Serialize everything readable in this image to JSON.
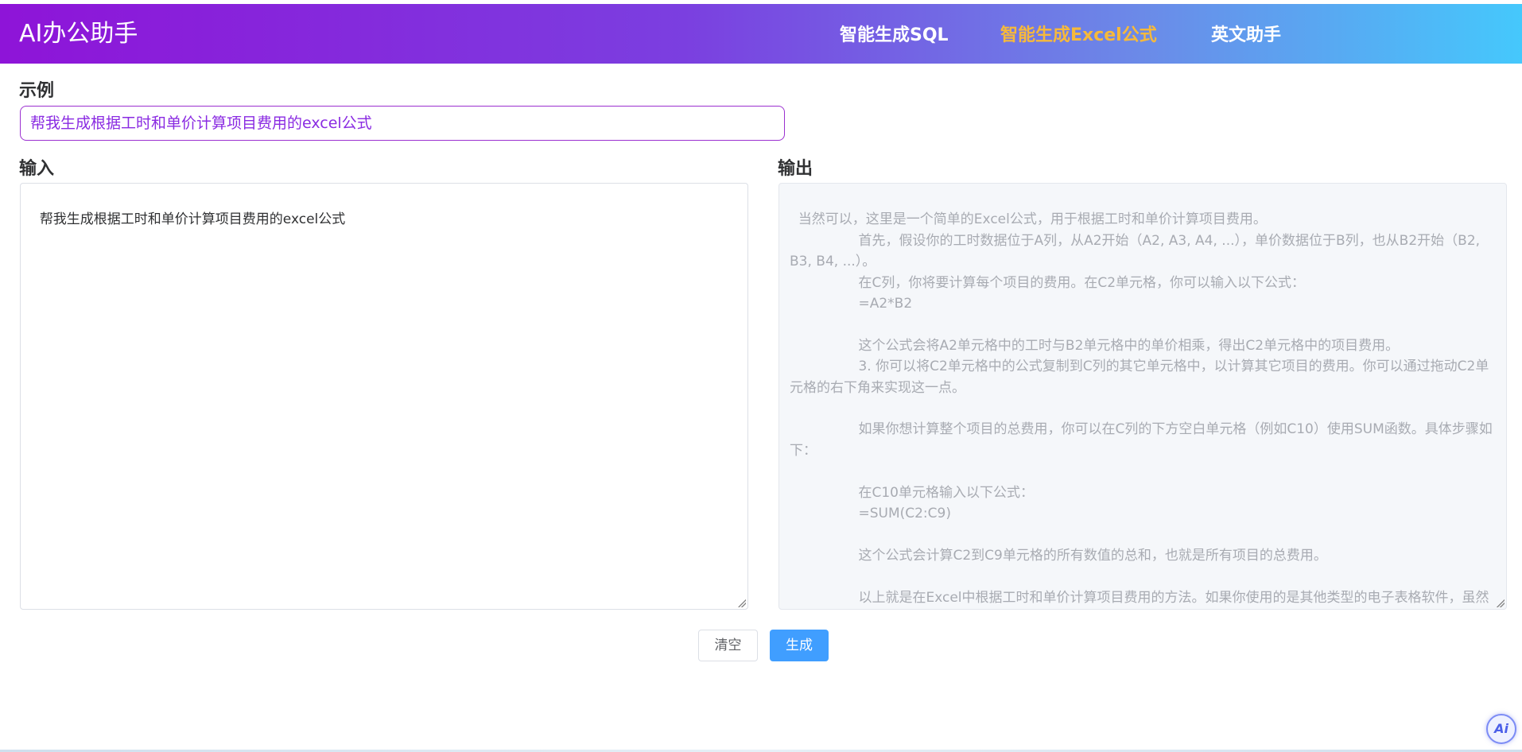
{
  "header": {
    "brand": "AI办公助手",
    "nav": [
      {
        "label": "智能生成SQL",
        "active": false
      },
      {
        "label": "智能生成Excel公式",
        "active": true
      },
      {
        "label": "英文助手",
        "active": false
      }
    ],
    "gradient_colors": [
      "#8e14d8",
      "#45c8fc"
    ],
    "active_color": "#f6b93b"
  },
  "example": {
    "label": "示例",
    "text": "帮我生成根据工时和单价计算项目费用的excel公式"
  },
  "input": {
    "label": "输入",
    "value": "帮我生成根据工时和单价计算项目费用的excel公式"
  },
  "output": {
    "label": "输出",
    "value": "当然可以，这里是一个简单的Excel公式，用于根据工时和单价计算项目费用。\n                首先，假设你的工时数据位于A列，从A2开始（A2, A3, A4, ...），单价数据位于B列，也从B2开始（B2, B3, B4, ...）。\n                在C列，你将要计算每个项目的费用。在C2单元格，你可以输入以下公式：\n                =A2*B2\n\n                这个公式会将A2单元格中的工时与B2单元格中的单价相乘，得出C2单元格中的项目费用。\n                3. 你可以将C2单元格中的公式复制到C列的其它单元格中，以计算其它项目的费用。你可以通过拖动C2单元格的右下角来实现这一点。\n\n                如果你想计算整个项目的总费用，你可以在C列的下方空白单元格（例如C10）使用SUM函数。具体步骤如下：\n\n                在C10单元格输入以下公式：\n                =SUM(C2:C9)\n\n                这个公式会计算C2到C9单元格的所有数值的总和，也就是所有项目的总费用。\n\n                以上就是在Excel中根据工时和单价计算项目费用的方法。如果你使用的是其他类型的电子表格软件，虽然具体的操作可能会有所不同，但基本的计算原理应该是相同的。"
  },
  "buttons": {
    "clear": "清空",
    "generate": "生成"
  },
  "ai_badge": {
    "label": "Ai",
    "icon": "ai-assistant-icon"
  }
}
